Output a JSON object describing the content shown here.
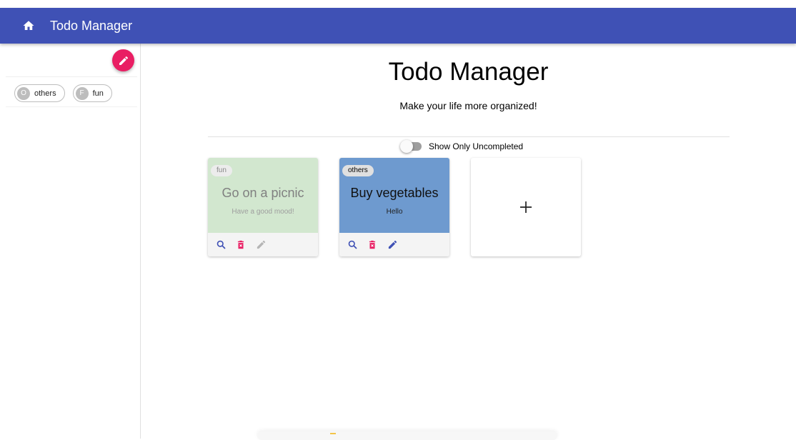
{
  "app_bar": {
    "title": "Todo Manager",
    "icon": "home-icon",
    "color": "#3f51b5"
  },
  "sidebar": {
    "fab_icon": "pencil-icon",
    "fab_color": "#e91e63",
    "filters": [
      {
        "avatar": "O",
        "label": "others"
      },
      {
        "avatar": "F",
        "label": "fun"
      }
    ]
  },
  "main": {
    "heading": "Todo Manager",
    "subheading": "Make your life more organized!",
    "toggle": {
      "label": "Show Only Uncompleted",
      "checked": false
    }
  },
  "todos": [
    {
      "tag": "fun",
      "title": "Go on a picnic",
      "description": "Have a good mood!",
      "color": "#d2e7cf",
      "completed": true,
      "actions": [
        "search-icon",
        "delete-icon",
        "pencil-icon"
      ]
    },
    {
      "tag": "others",
      "title": "Buy vegetables",
      "description": "Hello",
      "color": "#6e9acf",
      "completed": false,
      "actions": [
        "search-icon",
        "delete-icon",
        "pencil-icon"
      ]
    }
  ],
  "add_card": {
    "symbol": "+"
  },
  "colors": {
    "search": "#3f51b5",
    "delete": "#e91e63",
    "edit_active": "#3f51b5",
    "edit_disabled": "#b5b5b5"
  }
}
